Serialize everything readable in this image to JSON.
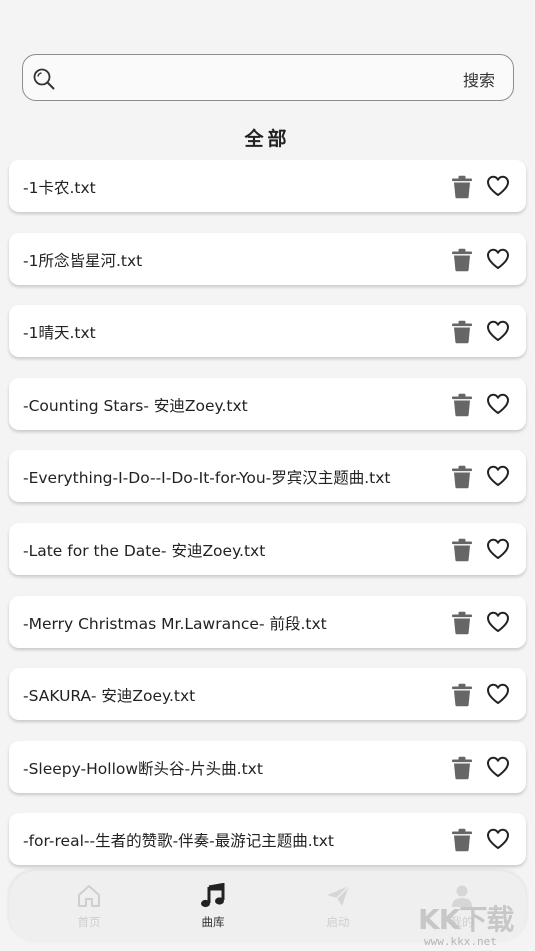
{
  "search": {
    "placeholder": "",
    "value": "",
    "button_label": "搜索"
  },
  "section": {
    "title": "全部"
  },
  "songs": [
    {
      "name": "-1卡农.txt"
    },
    {
      "name": "-1所念皆星河.txt"
    },
    {
      "name": "-1晴天.txt"
    },
    {
      "name": "-Counting Stars- 安迪Zoey.txt"
    },
    {
      "name": "-Everything-I-Do--I-Do-It-for-You-罗宾汉主题曲.txt"
    },
    {
      "name": "-Late for the Date- 安迪Zoey.txt"
    },
    {
      "name": "-Merry Christmas Mr.Lawrance- 前段.txt"
    },
    {
      "name": "-SAKURA- 安迪Zoey.txt"
    },
    {
      "name": "-Sleepy-Hollow断头谷-片头曲.txt"
    },
    {
      "name": "-for-real--生者的赞歌-伴奏-最游记主题曲.txt"
    }
  ],
  "nav": {
    "items": [
      {
        "label": "首页",
        "icon": "home-icon",
        "active": false
      },
      {
        "label": "曲库",
        "icon": "music-note-icon",
        "active": true
      },
      {
        "label": "启动",
        "icon": "paper-plane-icon",
        "active": false
      },
      {
        "label": "我的",
        "icon": "person-icon",
        "active": false
      }
    ]
  },
  "watermark": {
    "brand": "KK下载",
    "url": "www.kkx.net"
  },
  "colors": {
    "background": "#f4f4f4",
    "card": "#ffffff",
    "icon_gray": "#666666",
    "nav_inactive": "#cfcfcf"
  }
}
